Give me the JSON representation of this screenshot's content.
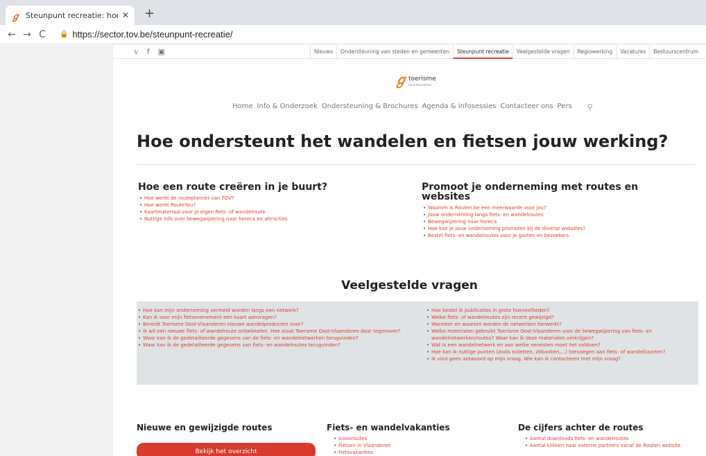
{
  "browser": {
    "tab_title": "Steunpunt recreatie: hoe onderst",
    "tab_close": "✕",
    "new_tab": "+",
    "url": "https://sector.tov.be/steunpunt-recreatie/",
    "back": "←",
    "forward": "→",
    "reload": "C",
    "lock": "🔒"
  },
  "topbar": {
    "social": [
      "𝕧",
      "f",
      "▣"
    ],
    "nav": [
      "Nieuws",
      "Ondersteuning van steden en gemeenten",
      "Steunpunt recreatie",
      "Veelgestelde vragen",
      "Regiowerking",
      "Vacatures",
      "Bestuurscentrum"
    ],
    "active_index": 2
  },
  "logo": {
    "mark": "∅",
    "word": "toerisme",
    "sub": "Oost-Vlaanderen"
  },
  "mainnav": {
    "items": [
      "Home",
      "Info & Onderzoek",
      "Ondersteuning & Brochures",
      "Agenda & infosessies",
      "Contacteer ons",
      "Pers"
    ],
    "search_icon": "⚲"
  },
  "hero": {
    "title": "Hoe ondersteunt het wandelen en fietsen jouw werking?"
  },
  "section1": {
    "title": "Hoe een route creëren in je buurt?",
    "links": [
      "Hoe werkt de routeplanner van TOV?",
      "Hoe werkt RouteYou?",
      "Kaartmateriaal voor je eigen fiets- of wandelroute",
      "Nuttige info over bewegwijzering naar horeca en attracties"
    ]
  },
  "section2": {
    "title": "Promoot je onderneming met routes en websites",
    "links": [
      "Waarom is Routen.be een meerwaarde voor jou?",
      "Jouw onderneming langs fiets- en wandelroutes",
      "Bewegwijzering naar horeca",
      "Hoe kan je jouw onderneming promoten bij de diverse websites?",
      "Bestel fiets- en wandelroutes voor je gasten en bezoekers"
    ]
  },
  "faq": {
    "title": "Veelgestelde vragen",
    "left": [
      "Hoe kan mijn onderneming vermeld worden langs een netwerk?",
      "Kan ik voor mijn fietsevenement een kaart aanvragen?",
      "Bereidt Toerisme Oost-Vlaanderen nieuwe wandelproducten voor?",
      "Ik wil een nieuwe fiets- of wandelroute ontwikkelen. Hoe staat Toerisme Oost-Vlaanderen daar tegenover?",
      "Waar kan ik de gedetailleerde gegevens van de fiets- en wandelnetwerken terugvinden?",
      "Waar kan ik de gedetailleerde gegevens van fiets- en wandelroutes terugvinden?"
    ],
    "right": [
      "Hoe bestel ik publicaties in grote hoeveelheden?",
      "Welke fiets- of wandelroutes zijn recent gewijzigd?",
      "Wanneer en waarom worden de netwerken herwerkt?",
      "Welke materialen gebruikt Toerisme Oost-Vlaanderen voor de bewegwijzering van fiets- en wandelnetwerken/routes? Waar kan ik deze materialen verkrijgen?",
      "Wat is een wandelnetwerk en aan welke vereisten moet het voldoen?",
      "Hoe kan ik nuttige punten (zoals toiletten, zitbanken,...) toevoegen aan fiets- of wandelkaarten?",
      "Ik vind geen antwoord op mijn vraag. Wie kan ik contacteren met mijn vraag?"
    ]
  },
  "bottom": {
    "col1": {
      "title": "Nieuwe en gewijzigde routes",
      "button": "Bekijk het overzicht"
    },
    "col2": {
      "title": "Fiets- en wandelvakanties",
      "links": [
        "Icoonroutes",
        "Fietsen in Vlaanderen",
        "Fietsvakanties"
      ]
    },
    "col3": {
      "title": "De cijfers achter de routes",
      "links": [
        "Aantal downloads fiets- en wandelroutes",
        "Aantal klikken naar externe partners vanaf de Routen website"
      ]
    }
  }
}
